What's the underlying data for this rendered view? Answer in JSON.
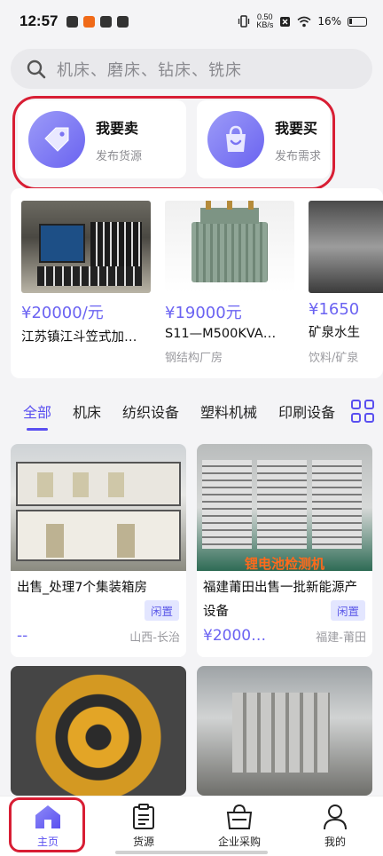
{
  "status_bar": {
    "time": "12:57",
    "net_speed_value": "0.50",
    "net_speed_unit": "KB/s",
    "battery": "16%"
  },
  "search": {
    "placeholder": "机床、磨床、钻床、铣床"
  },
  "actions": [
    {
      "title": "我要卖",
      "subtitle": "发布货源",
      "icon": "tag-icon"
    },
    {
      "title": "我要买",
      "subtitle": "发布需求",
      "icon": "shopping-bag-icon"
    }
  ],
  "featured": [
    {
      "price": "¥20000/元",
      "name": "江苏镇江斗笠式加…",
      "category": ""
    },
    {
      "price": "¥19000元",
      "name": "S11—M500KVA…",
      "category": "钢结构厂房"
    },
    {
      "price": "¥1650",
      "name": "矿泉水生",
      "category": "饮料/矿泉"
    }
  ],
  "tabs": [
    "全部",
    "机床",
    "纺织设备",
    "塑料机械",
    "印刷设备"
  ],
  "feed": [
    {
      "title": "出售_处理7个集装箱房",
      "tag": "闲置",
      "price": "--",
      "location": "山西-长治"
    },
    {
      "title": "福建莆田出售一批新能源产设备",
      "tag": "闲置",
      "price": "¥2000…",
      "location": "福建-莆田",
      "image_caption": "锂电池检测机"
    },
    {
      "title": "",
      "tag": "",
      "price": "",
      "location": ""
    },
    {
      "title": "",
      "tag": "",
      "price": "",
      "location": ""
    }
  ],
  "nav": [
    {
      "label": "主页",
      "icon": "home-icon"
    },
    {
      "label": "货源",
      "icon": "document-icon"
    },
    {
      "label": "企业采购",
      "icon": "shopping-bag-icon"
    },
    {
      "label": "我的",
      "icon": "user-icon"
    }
  ],
  "colors": {
    "accent": "#5a4ff0",
    "price": "#6b63f2",
    "highlight_border": "#d81e34"
  }
}
